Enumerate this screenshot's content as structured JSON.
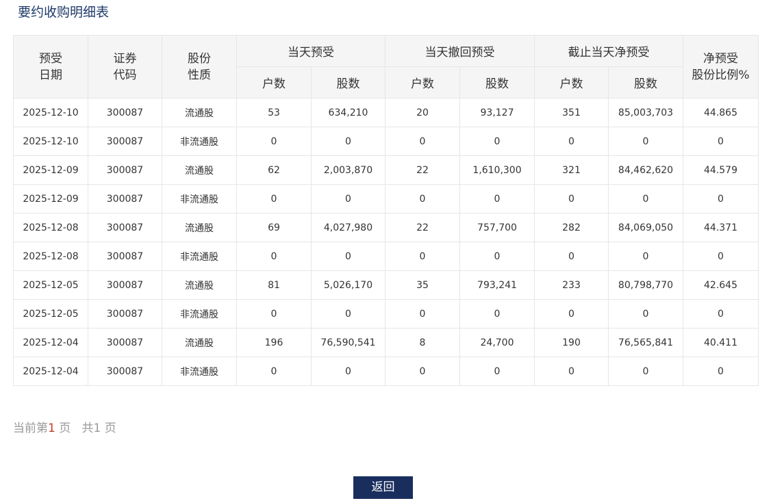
{
  "page": {
    "title": "要约收购明细表"
  },
  "table": {
    "headers": {
      "date": [
        "预受",
        "日期"
      ],
      "code": [
        "证券",
        "代码"
      ],
      "nature": [
        "股份",
        "性质"
      ],
      "today": "当天预受",
      "withdraw": "当天撤回预受",
      "net": "截止当天净预受",
      "ratio": [
        "净预受",
        "股份比例%"
      ],
      "accounts": "户数",
      "shares": "股数"
    },
    "rows": [
      [
        "2025-12-10",
        "300087",
        "流通股",
        "53",
        "634,210",
        "20",
        "93,127",
        "351",
        "85,003,703",
        "44.865"
      ],
      [
        "2025-12-10",
        "300087",
        "非流通股",
        "0",
        "0",
        "0",
        "0",
        "0",
        "0",
        "0"
      ],
      [
        "2025-12-09",
        "300087",
        "流通股",
        "62",
        "2,003,870",
        "22",
        "1,610,300",
        "321",
        "84,462,620",
        "44.579"
      ],
      [
        "2025-12-09",
        "300087",
        "非流通股",
        "0",
        "0",
        "0",
        "0",
        "0",
        "0",
        "0"
      ],
      [
        "2025-12-08",
        "300087",
        "流通股",
        "69",
        "4,027,980",
        "22",
        "757,700",
        "282",
        "84,069,050",
        "44.371"
      ],
      [
        "2025-12-08",
        "300087",
        "非流通股",
        "0",
        "0",
        "0",
        "0",
        "0",
        "0",
        "0"
      ],
      [
        "2025-12-05",
        "300087",
        "流通股",
        "81",
        "5,026,170",
        "35",
        "793,241",
        "233",
        "80,798,770",
        "42.645"
      ],
      [
        "2025-12-05",
        "300087",
        "非流通股",
        "0",
        "0",
        "0",
        "0",
        "0",
        "0",
        "0"
      ],
      [
        "2025-12-04",
        "300087",
        "流通股",
        "196",
        "76,590,541",
        "8",
        "24,700",
        "190",
        "76,565,841",
        "40.411"
      ],
      [
        "2025-12-04",
        "300087",
        "非流通股",
        "0",
        "0",
        "0",
        "0",
        "0",
        "0",
        "0"
      ]
    ]
  },
  "pager": {
    "prefix": "当前第",
    "current": "1",
    "page_word": "页",
    "total_prefix": "共",
    "total": "1",
    "total_suffix": "页"
  },
  "actions": {
    "back_label": "返回"
  },
  "colors": {
    "title": "#1f3a6b",
    "button_bg": "#1a2e5e",
    "pager_current": "#c0392b",
    "header_bg": "#f5f5f5"
  }
}
